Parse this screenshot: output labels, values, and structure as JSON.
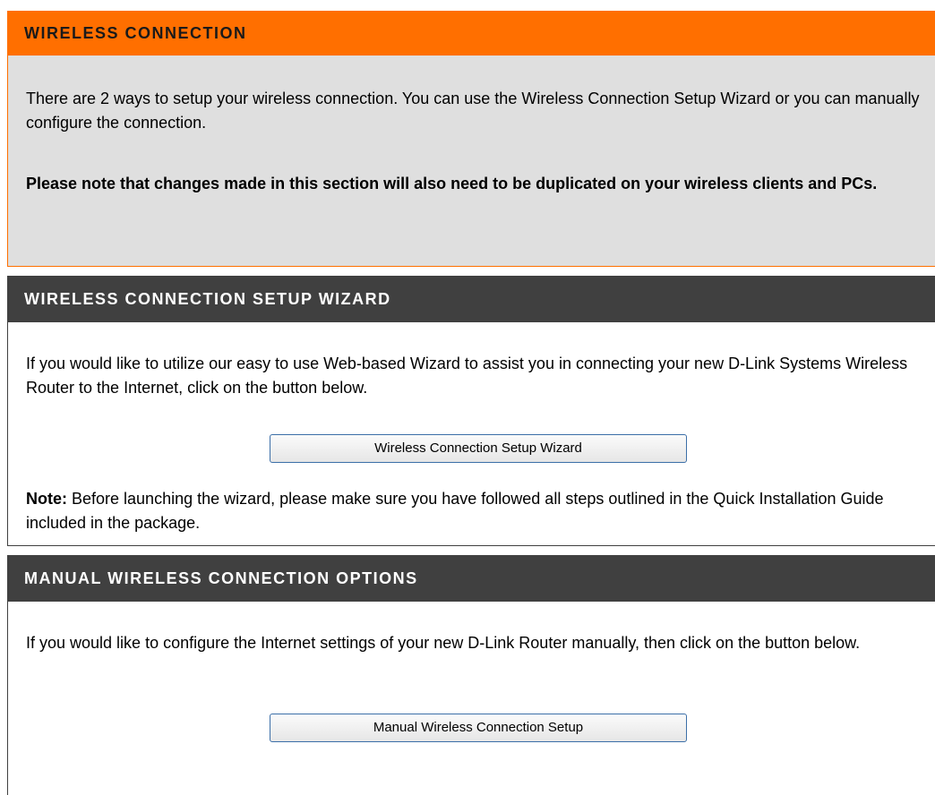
{
  "colors": {
    "orange_header": "#ff6f00",
    "dark_header": "#404040",
    "grey_panel": "#dfdfdf",
    "button_border": "#3c6fa8"
  },
  "wireless_connection": {
    "title": "WIRELESS CONNECTION",
    "intro": "There are 2 ways to setup your wireless connection. You can use the Wireless Connection Setup Wizard or you can manually configure the connection.",
    "note": "Please note that changes made in this section will also need to be duplicated on your wireless clients and PCs."
  },
  "setup_wizard": {
    "title": "WIRELESS CONNECTION SETUP WIZARD",
    "description": "If you would like to utilize our easy to use Web-based Wizard to assist you in connecting your new D-Link Systems Wireless Router to the Internet, click on the button below.",
    "button_label": "Wireless Connection Setup Wizard",
    "note_label": "Note:",
    "note_text": " Before launching the wizard, please make sure you have followed all steps outlined in the Quick Installation Guide included in the package."
  },
  "manual_options": {
    "title": "MANUAL WIRELESS CONNECTION OPTIONS",
    "description": "If you would like to configure the Internet settings of your new D-Link Router manually, then click on the button below.",
    "button_label": "Manual Wireless Connection Setup"
  }
}
